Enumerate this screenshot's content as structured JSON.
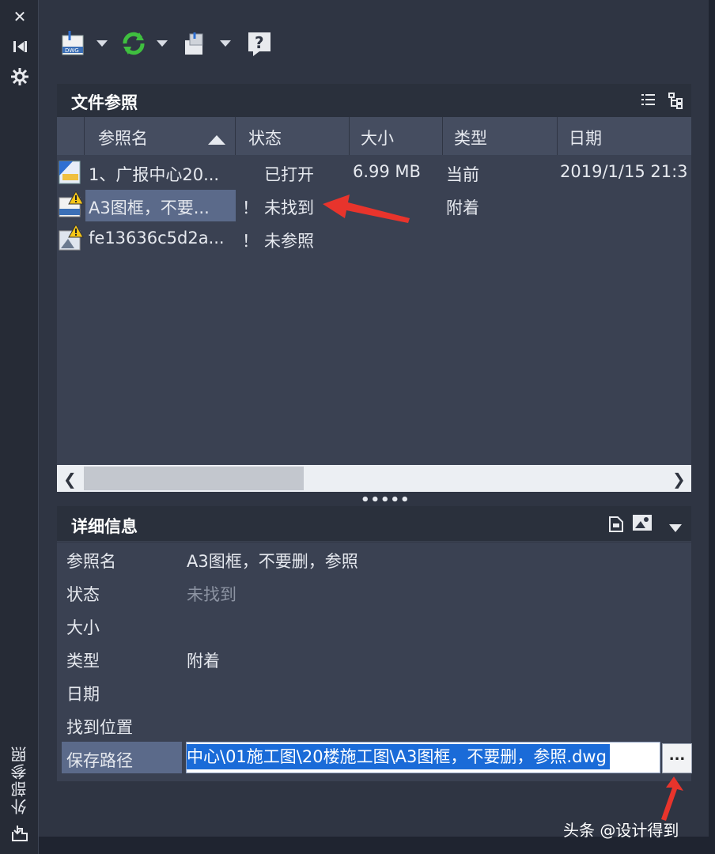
{
  "sidebar": {
    "title": "外部参照"
  },
  "toolbar": {
    "buttons": [
      {
        "name": "attach-dwg-button",
        "icon": "dwg-attach-icon"
      },
      {
        "name": "refresh-button",
        "icon": "refresh-icon"
      },
      {
        "name": "change-path-button",
        "icon": "path-icon"
      },
      {
        "name": "help-button",
        "icon": "help-icon"
      }
    ]
  },
  "file_references": {
    "title": "文件参照",
    "columns": [
      "参照名",
      "状态",
      "大小",
      "类型",
      "日期"
    ],
    "rows": [
      {
        "name": "1、广报中心20...",
        "flag": "",
        "status": "已打开",
        "size": "6.99 MB",
        "type": "当前",
        "date": "2019/1/15 21:3",
        "icon": "dwg-file-icon"
      },
      {
        "name": "A3图框，不要...",
        "flag": "！",
        "status": "未找到",
        "size": "",
        "type": "附着",
        "date": "",
        "icon": "dwg-warning-icon"
      },
      {
        "name": "fe13636c5d2a...",
        "flag": "！",
        "status": "未参照",
        "size": "",
        "type": "",
        "date": "",
        "icon": "image-warning-icon"
      }
    ]
  },
  "details": {
    "title": "详细信息",
    "labels": {
      "ref_name": "参照名",
      "status": "状态",
      "size": "大小",
      "type": "类型",
      "date": "日期",
      "found_at": "找到位置",
      "saved_path": "保存路径"
    },
    "values": {
      "ref_name": "A3图框，不要删，参照",
      "status": "未找到",
      "type": "附着",
      "saved_path": "中心\\01施工图\\20楼施工图\\A3图框，不要删，参照.dwg"
    },
    "browse_label": "..."
  },
  "watermark": "头条 @设计得到",
  "colors": {
    "panel": "#2f3543",
    "selection": "#1a6bd8",
    "annotation_arrow": "#e8342c"
  }
}
